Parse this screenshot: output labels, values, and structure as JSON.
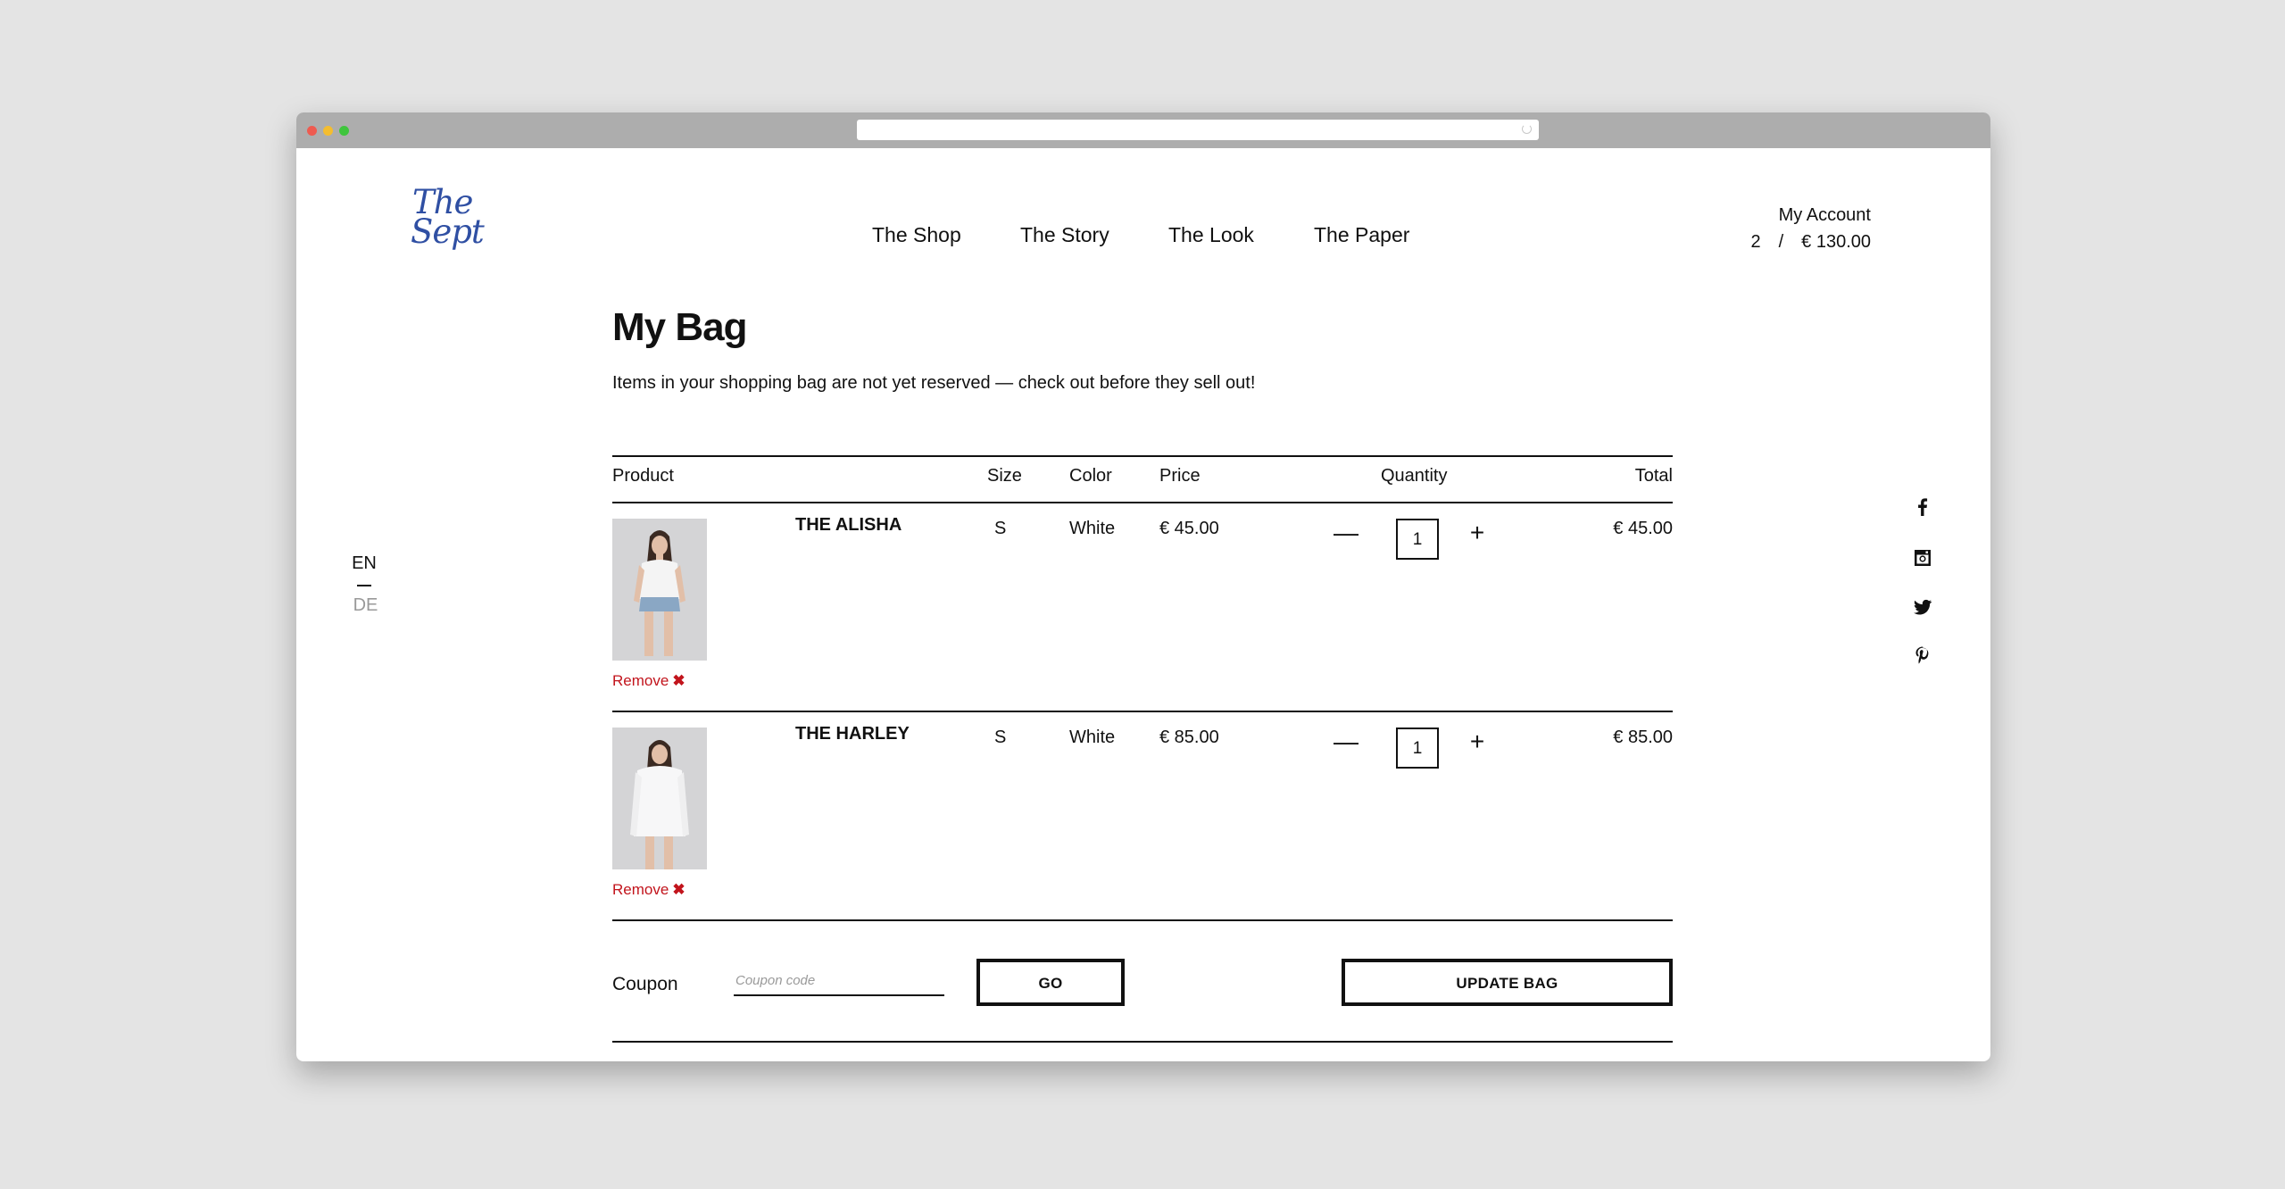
{
  "brand": {
    "logo_line1": "The",
    "logo_line2": "Sept"
  },
  "nav": {
    "items": [
      "The Shop",
      "The Story",
      "The Look",
      "The Paper"
    ]
  },
  "account": {
    "label": "My Account",
    "item_count": "2",
    "separator": "/",
    "cart_total": "€ 130.00"
  },
  "language": {
    "current": "EN",
    "other": "DE"
  },
  "social": {
    "icons": [
      "facebook-icon",
      "instagram-icon",
      "twitter-icon",
      "pinterest-icon"
    ]
  },
  "bag": {
    "title": "My Bag",
    "notice": "Items in your shopping bag are not yet reserved — check out before they sell out!",
    "columns": {
      "product": "Product",
      "size": "Size",
      "color": "Color",
      "price": "Price",
      "quantity": "Quantity",
      "total": "Total"
    },
    "items": [
      {
        "name": "THE ALISHA",
        "size": "S",
        "color": "White",
        "price": "€ 45.00",
        "quantity": "1",
        "total": "€ 45.00",
        "remove_label": "Remove"
      },
      {
        "name": "THE HARLEY",
        "size": "S",
        "color": "White",
        "price": "€ 85.00",
        "quantity": "1",
        "total": "€ 85.00",
        "remove_label": "Remove"
      }
    ],
    "quantity_minus": "—",
    "quantity_plus": "+",
    "remove_icon": "✖"
  },
  "coupon": {
    "label": "Coupon",
    "placeholder": "Coupon code",
    "value": "",
    "go_label": "GO"
  },
  "update_label": "UPDATE BAG",
  "colors": {
    "logo": "#2f4fa3",
    "remove": "#c2141c",
    "background": "#e4e4e4"
  }
}
